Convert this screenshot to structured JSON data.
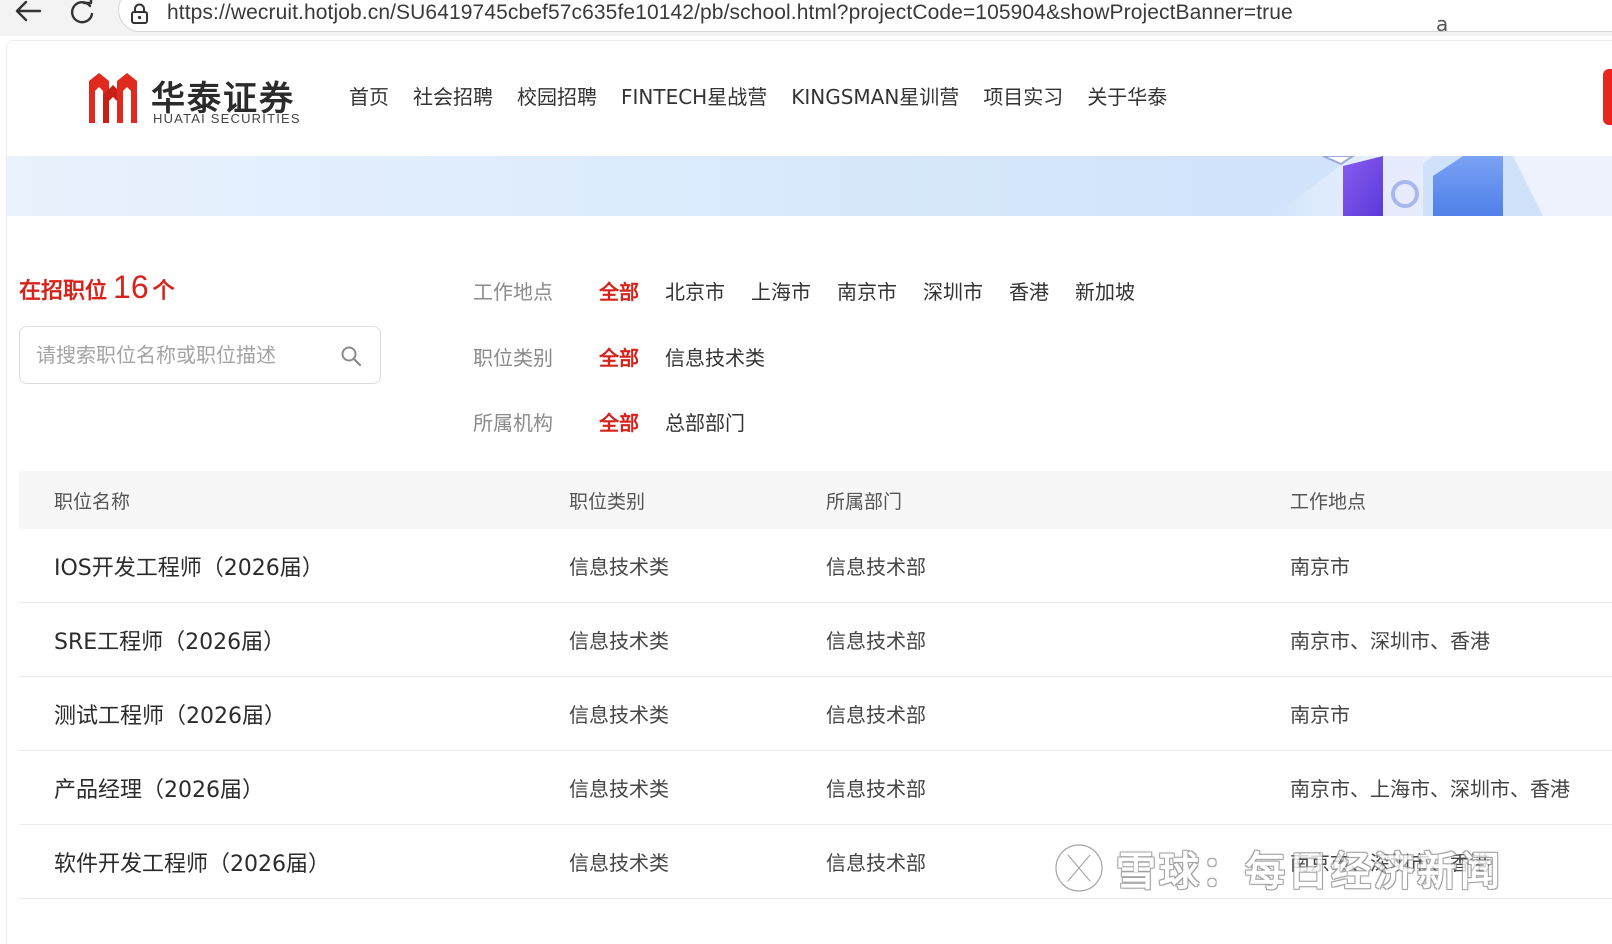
{
  "browser": {
    "url": "https://wecruit.hotjob.cn/SU6419745cbef57c635fe10142/pb/school.html?projectCode=105904&showProjectBanner=true",
    "url_tail": "a"
  },
  "header": {
    "logo_cn": "华泰证券",
    "logo_en": "HUATAI SECURITIES",
    "nav": [
      "首页",
      "社会招聘",
      "校园招聘",
      "FINTECH星战营",
      "KINGSMAN星训营",
      "项目实习",
      "关于华泰"
    ]
  },
  "summary": {
    "label": "在招职位",
    "count": "16",
    "unit": "个"
  },
  "search": {
    "placeholder": "请搜索职位名称或职位描述",
    "value": ""
  },
  "filters": {
    "location": {
      "label": "工作地点",
      "options": [
        "全部",
        "北京市",
        "上海市",
        "南京市",
        "深圳市",
        "香港",
        "新加坡"
      ],
      "selected": "全部"
    },
    "category": {
      "label": "职位类别",
      "options": [
        "全部",
        "信息技术类"
      ],
      "selected": "全部"
    },
    "organization": {
      "label": "所属机构",
      "options": [
        "全部",
        "总部部门"
      ],
      "selected": "全部"
    }
  },
  "table": {
    "headers": [
      "职位名称",
      "职位类别",
      "所属部门",
      "工作地点"
    ],
    "rows": [
      {
        "title": "IOS开发工程师（2026届）",
        "category": "信息技术类",
        "department": "信息技术部",
        "location": "南京市"
      },
      {
        "title": "SRE工程师（2026届）",
        "category": "信息技术类",
        "department": "信息技术部",
        "location": "南京市、深圳市、香港"
      },
      {
        "title": "测试工程师（2026届）",
        "category": "信息技术类",
        "department": "信息技术部",
        "location": "南京市"
      },
      {
        "title": "产品经理（2026届）",
        "category": "信息技术类",
        "department": "信息技术部",
        "location": "南京市、上海市、深圳市、香港"
      },
      {
        "title": "软件开发工程师（2026届）",
        "category": "信息技术类",
        "department": "信息技术部",
        "location": "南京市、深圳市、香港"
      }
    ]
  },
  "watermark": {
    "text": "雪球：每日经济新闻"
  },
  "colors": {
    "brand_red": "#d6241c",
    "banner_blue": "#dcebfc",
    "header_bg": "#f7f7f7"
  },
  "icons": {
    "back": "arrow-left-icon",
    "reload": "reload-icon",
    "lock": "lock-icon",
    "search": "search-icon",
    "logo": "huatai-logo-icon",
    "watermark": "xueqiu-logo-icon"
  }
}
